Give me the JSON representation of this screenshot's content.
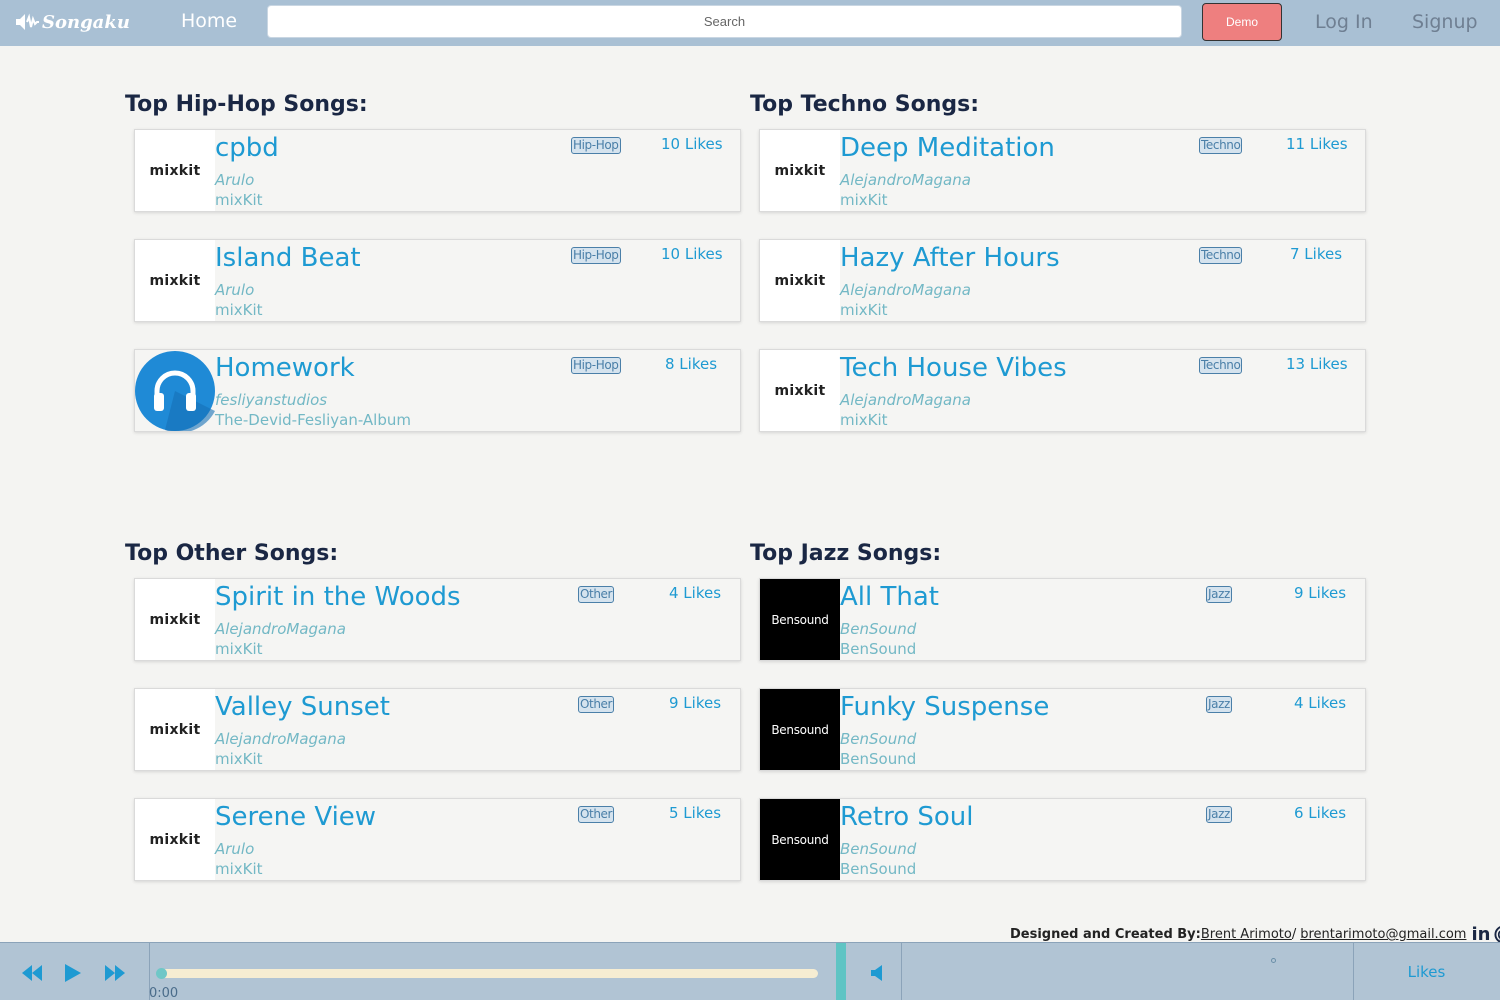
{
  "nav": {
    "logo_text": "Songaku",
    "home": "Home",
    "search_placeholder": "Search",
    "demo": "Demo",
    "login": "Log In",
    "signup": "Signup"
  },
  "sections": [
    {
      "title": "Top Hip-Hop Songs:",
      "songs": [
        {
          "title": "cpbd",
          "artist": "Arulo",
          "album": "mixKit",
          "genre": "Hip-Hop",
          "likes": "10 Likes",
          "thumb": "mixkit"
        },
        {
          "title": "Island Beat",
          "artist": "Arulo",
          "album": "mixKit",
          "genre": "Hip-Hop",
          "likes": "10 Likes",
          "thumb": "mixkit"
        },
        {
          "title": "Homework",
          "artist": "fesliyanstudios",
          "album": "The-Devid-Fesliyan-Album",
          "genre": "Hip-Hop",
          "likes": "8 Likes",
          "thumb": "headphone"
        }
      ]
    },
    {
      "title": "Top Techno Songs:",
      "songs": [
        {
          "title": "Deep Meditation",
          "artist": "AlejandroMagana",
          "album": "mixKit",
          "genre": "Techno",
          "likes": "11 Likes",
          "thumb": "mixkit"
        },
        {
          "title": "Hazy After Hours",
          "artist": "AlejandroMagana",
          "album": "mixKit",
          "genre": "Techno",
          "likes": "7 Likes",
          "thumb": "mixkit"
        },
        {
          "title": "Tech House Vibes",
          "artist": "AlejandroMagana",
          "album": "mixKit",
          "genre": "Techno",
          "likes": "13 Likes",
          "thumb": "mixkit"
        }
      ]
    },
    {
      "title": "Top Other Songs:",
      "songs": [
        {
          "title": "Spirit in the Woods",
          "artist": "AlejandroMagana",
          "album": "mixKit",
          "genre": "Other",
          "likes": "4 Likes",
          "thumb": "mixkit"
        },
        {
          "title": "Valley Sunset",
          "artist": "AlejandroMagana",
          "album": "mixKit",
          "genre": "Other",
          "likes": "9 Likes",
          "thumb": "mixkit"
        },
        {
          "title": "Serene View",
          "artist": "Arulo",
          "album": "mixKit",
          "genre": "Other",
          "likes": "5 Likes",
          "thumb": "mixkit"
        }
      ]
    },
    {
      "title": "Top Jazz Songs:",
      "songs": [
        {
          "title": "All That",
          "artist": "BenSound",
          "album": "BenSound",
          "genre": "Jazz",
          "likes": "9 Likes",
          "thumb": "bensound"
        },
        {
          "title": "Funky Suspense",
          "artist": "BenSound",
          "album": "BenSound",
          "genre": "Jazz",
          "likes": "4 Likes",
          "thumb": "bensound"
        },
        {
          "title": "Retro Soul",
          "artist": "BenSound",
          "album": "BenSound",
          "genre": "Jazz",
          "likes": "6 Likes",
          "thumb": "bensound"
        }
      ]
    }
  ],
  "thumb_labels": {
    "mixkit": "mixkit",
    "bensound": "Bensound"
  },
  "footer": {
    "credit_label": "Designed and Created By:",
    "author": "Brent Arimoto",
    "separator": "/",
    "email": "brentarimoto@gmail.com",
    "linkedin": "in",
    "github_icon": "github-icon"
  },
  "player": {
    "time": "0:00",
    "progress": 0,
    "likes_tab": "Likes"
  },
  "colors": {
    "nav_bg": "#a9c0d4",
    "accent": "#1e9ad2",
    "secondary_text": "#73b8c5",
    "demo_bg": "#ee7f7f",
    "heading": "#1a2744",
    "player_bg": "#b1c4d4",
    "progress_track": "#f6edd2",
    "teal": "#5fc4c4"
  }
}
